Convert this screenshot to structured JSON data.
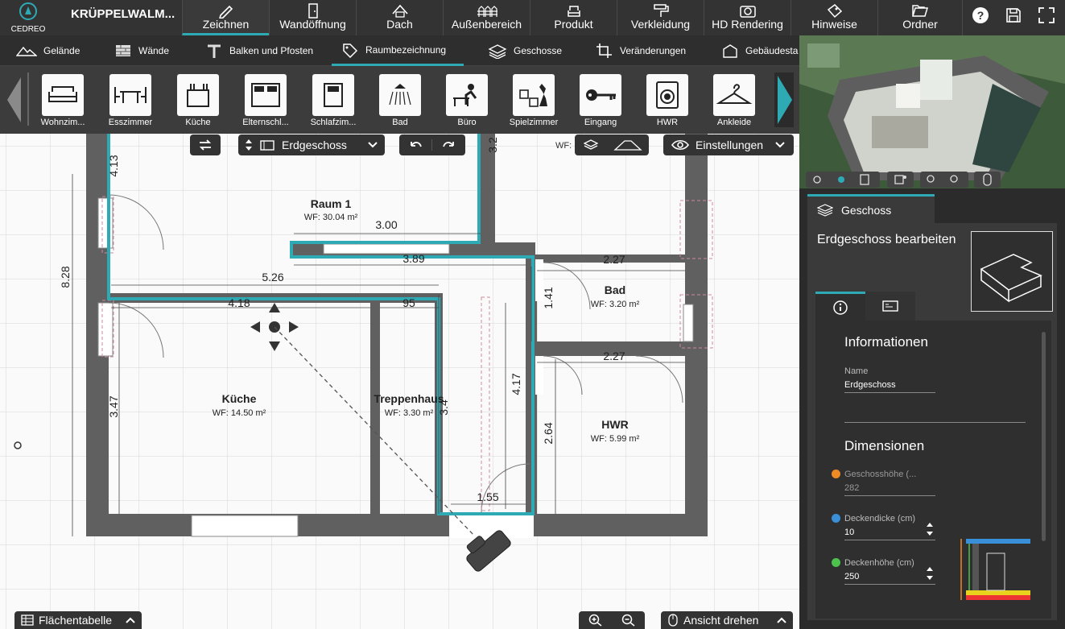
{
  "app": {
    "brand": "CEDREO",
    "project_name": "KRÜPPELWALM..."
  },
  "main_tabs": [
    {
      "label": "Zeichnen",
      "icon": "pencil-icon",
      "active": true
    },
    {
      "label": "Wandöffnung",
      "icon": "door-icon"
    },
    {
      "label": "Dach",
      "icon": "roof-icon"
    },
    {
      "label": "Außenbereich",
      "icon": "fence-icon"
    },
    {
      "label": "Produkt",
      "icon": "armchair-icon"
    },
    {
      "label": "Verkleidung",
      "icon": "paint-roller-icon"
    },
    {
      "label": "HD Rendering",
      "icon": "camera-icon"
    },
    {
      "label": "Hinweise",
      "icon": "note-icon"
    },
    {
      "label": "Ordner",
      "icon": "folder-icon"
    }
  ],
  "top_actions": {
    "help": "?",
    "save_icon": "save-icon",
    "fullscreen_icon": "fullscreen-icon"
  },
  "sub_tabs": [
    {
      "label": "Gelände",
      "icon": "terrain-icon"
    },
    {
      "label": "Wände",
      "icon": "brick-wall-icon"
    },
    {
      "label": "Balken und Pfosten",
      "icon": "beam-icon"
    },
    {
      "label": "Raumbezeichnung",
      "icon": "tag-icon",
      "active": true
    },
    {
      "label": "Geschosse",
      "icon": "layers-icon"
    },
    {
      "label": "Veränderungen",
      "icon": "crop-icon"
    },
    {
      "label": "Gebäudesta",
      "icon": "building-icon"
    }
  ],
  "room_categories": [
    {
      "label": "Wohnzim...",
      "icon": "sofa-icon"
    },
    {
      "label": "Esszimmer",
      "icon": "dining-table-icon"
    },
    {
      "label": "Küche",
      "icon": "kitchen-icon"
    },
    {
      "label": "Elternschl...",
      "icon": "double-bed-icon"
    },
    {
      "label": "Schlafzim...",
      "icon": "bed-icon"
    },
    {
      "label": "Bad",
      "icon": "shower-icon"
    },
    {
      "label": "Büro",
      "icon": "desk-icon"
    },
    {
      "label": "Spielzimmer",
      "icon": "games-icon"
    },
    {
      "label": "Eingang",
      "icon": "key-icon"
    },
    {
      "label": "HWR",
      "icon": "washing-machine-icon"
    },
    {
      "label": "Ankleide",
      "icon": "hanger-icon"
    }
  ],
  "canvas_toolbar": {
    "floor_select": "Erdgeschoss",
    "settings_label": "Einstellungen",
    "wf_label": "WF:"
  },
  "floor_plan": {
    "rooms": [
      {
        "name": "Raum 1",
        "area": "WF: 30.04 m²"
      },
      {
        "name": "Bad",
        "area": "WF: 3.20 m²"
      },
      {
        "name": "Küche",
        "area": "WF: 14.50 m²"
      },
      {
        "name": "Treppenhaus",
        "area": "WF: 3.30 m²"
      },
      {
        "name": "HWR",
        "area": "WF: 5.99 m²"
      }
    ],
    "dimensions": [
      "4.13",
      "3.00",
      "3.89",
      "2.27",
      "5.26",
      "8.28",
      "4.18",
      "95",
      "1.41",
      "2.27",
      "4.17",
      "3.47",
      "3.4",
      "2.64",
      "1.55",
      "3.2"
    ]
  },
  "bottom_bar": {
    "area_table": "Flächentabelle",
    "rotate_view": "Ansicht drehen"
  },
  "panel": {
    "tab_label": "Geschoss",
    "title": "Erdgeschoss bearbeiten",
    "info_heading": "Informationen",
    "name_label": "Name",
    "name_value": "Erdgeschoss",
    "dim_heading": "Dimensionen",
    "fields": [
      {
        "label": "Geschosshöhe (...",
        "value": "282",
        "color": "#f08a24",
        "disabled": true
      },
      {
        "label": "Deckendicke (cm)",
        "value": "10",
        "color": "#3a8fd9"
      },
      {
        "label": "Deckenhöhe (cm)",
        "value": "250",
        "color": "#4cc34c"
      }
    ]
  },
  "colors": {
    "accent": "#2eaab5",
    "wall": "#606060",
    "selected_room": "#2eaab5"
  }
}
